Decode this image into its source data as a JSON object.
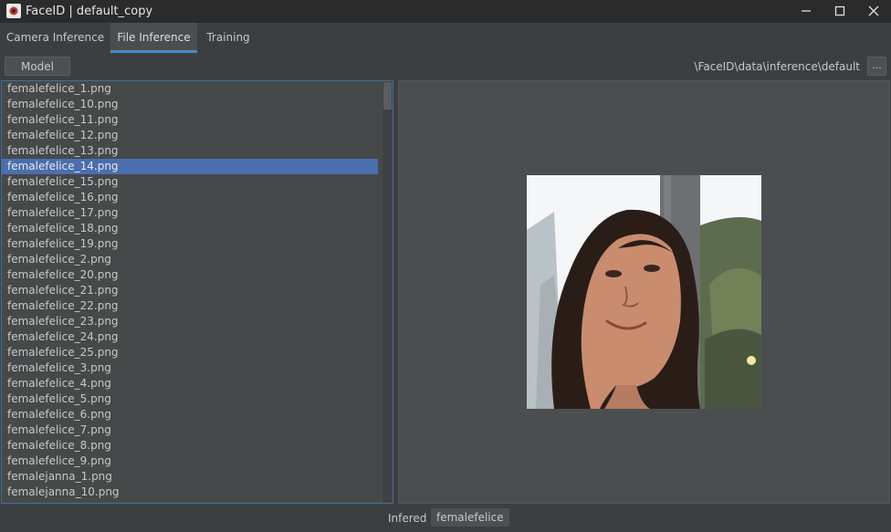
{
  "window": {
    "title": "FaceID | default_copy",
    "controls": [
      "minimize-icon",
      "maximize-icon",
      "close-icon"
    ]
  },
  "tabs": [
    {
      "label": "Camera Inference",
      "active": false
    },
    {
      "label": "File Inference",
      "active": true
    },
    {
      "label": "Training",
      "active": false
    }
  ],
  "toolbar": {
    "model_label": "Model",
    "path": "\\FaceID\\data\\inference\\default",
    "browse_label": "..."
  },
  "file_list": {
    "selected": "femalefelice_14.png",
    "items": [
      "femalefelice_1.png",
      "femalefelice_10.png",
      "femalefelice_11.png",
      "femalefelice_12.png",
      "femalefelice_13.png",
      "femalefelice_14.png",
      "femalefelice_15.png",
      "femalefelice_16.png",
      "femalefelice_17.png",
      "femalefelice_18.png",
      "femalefelice_19.png",
      "femalefelice_2.png",
      "femalefelice_20.png",
      "femalefelice_21.png",
      "femalefelice_22.png",
      "femalefelice_23.png",
      "femalefelice_24.png",
      "femalefelice_25.png",
      "femalefelice_3.png",
      "femalefelice_4.png",
      "femalefelice_5.png",
      "femalefelice_6.png",
      "femalefelice_7.png",
      "femalefelice_8.png",
      "femalefelice_9.png",
      "femalejanna_1.png",
      "femalejanna_10.png"
    ]
  },
  "status": {
    "label": "Infered",
    "value": "femalefelice"
  },
  "colors": {
    "accent": "#4a88c7",
    "selection": "#4b6eaf",
    "background": "#3c3f41",
    "titlebar": "#2b2b2b"
  }
}
